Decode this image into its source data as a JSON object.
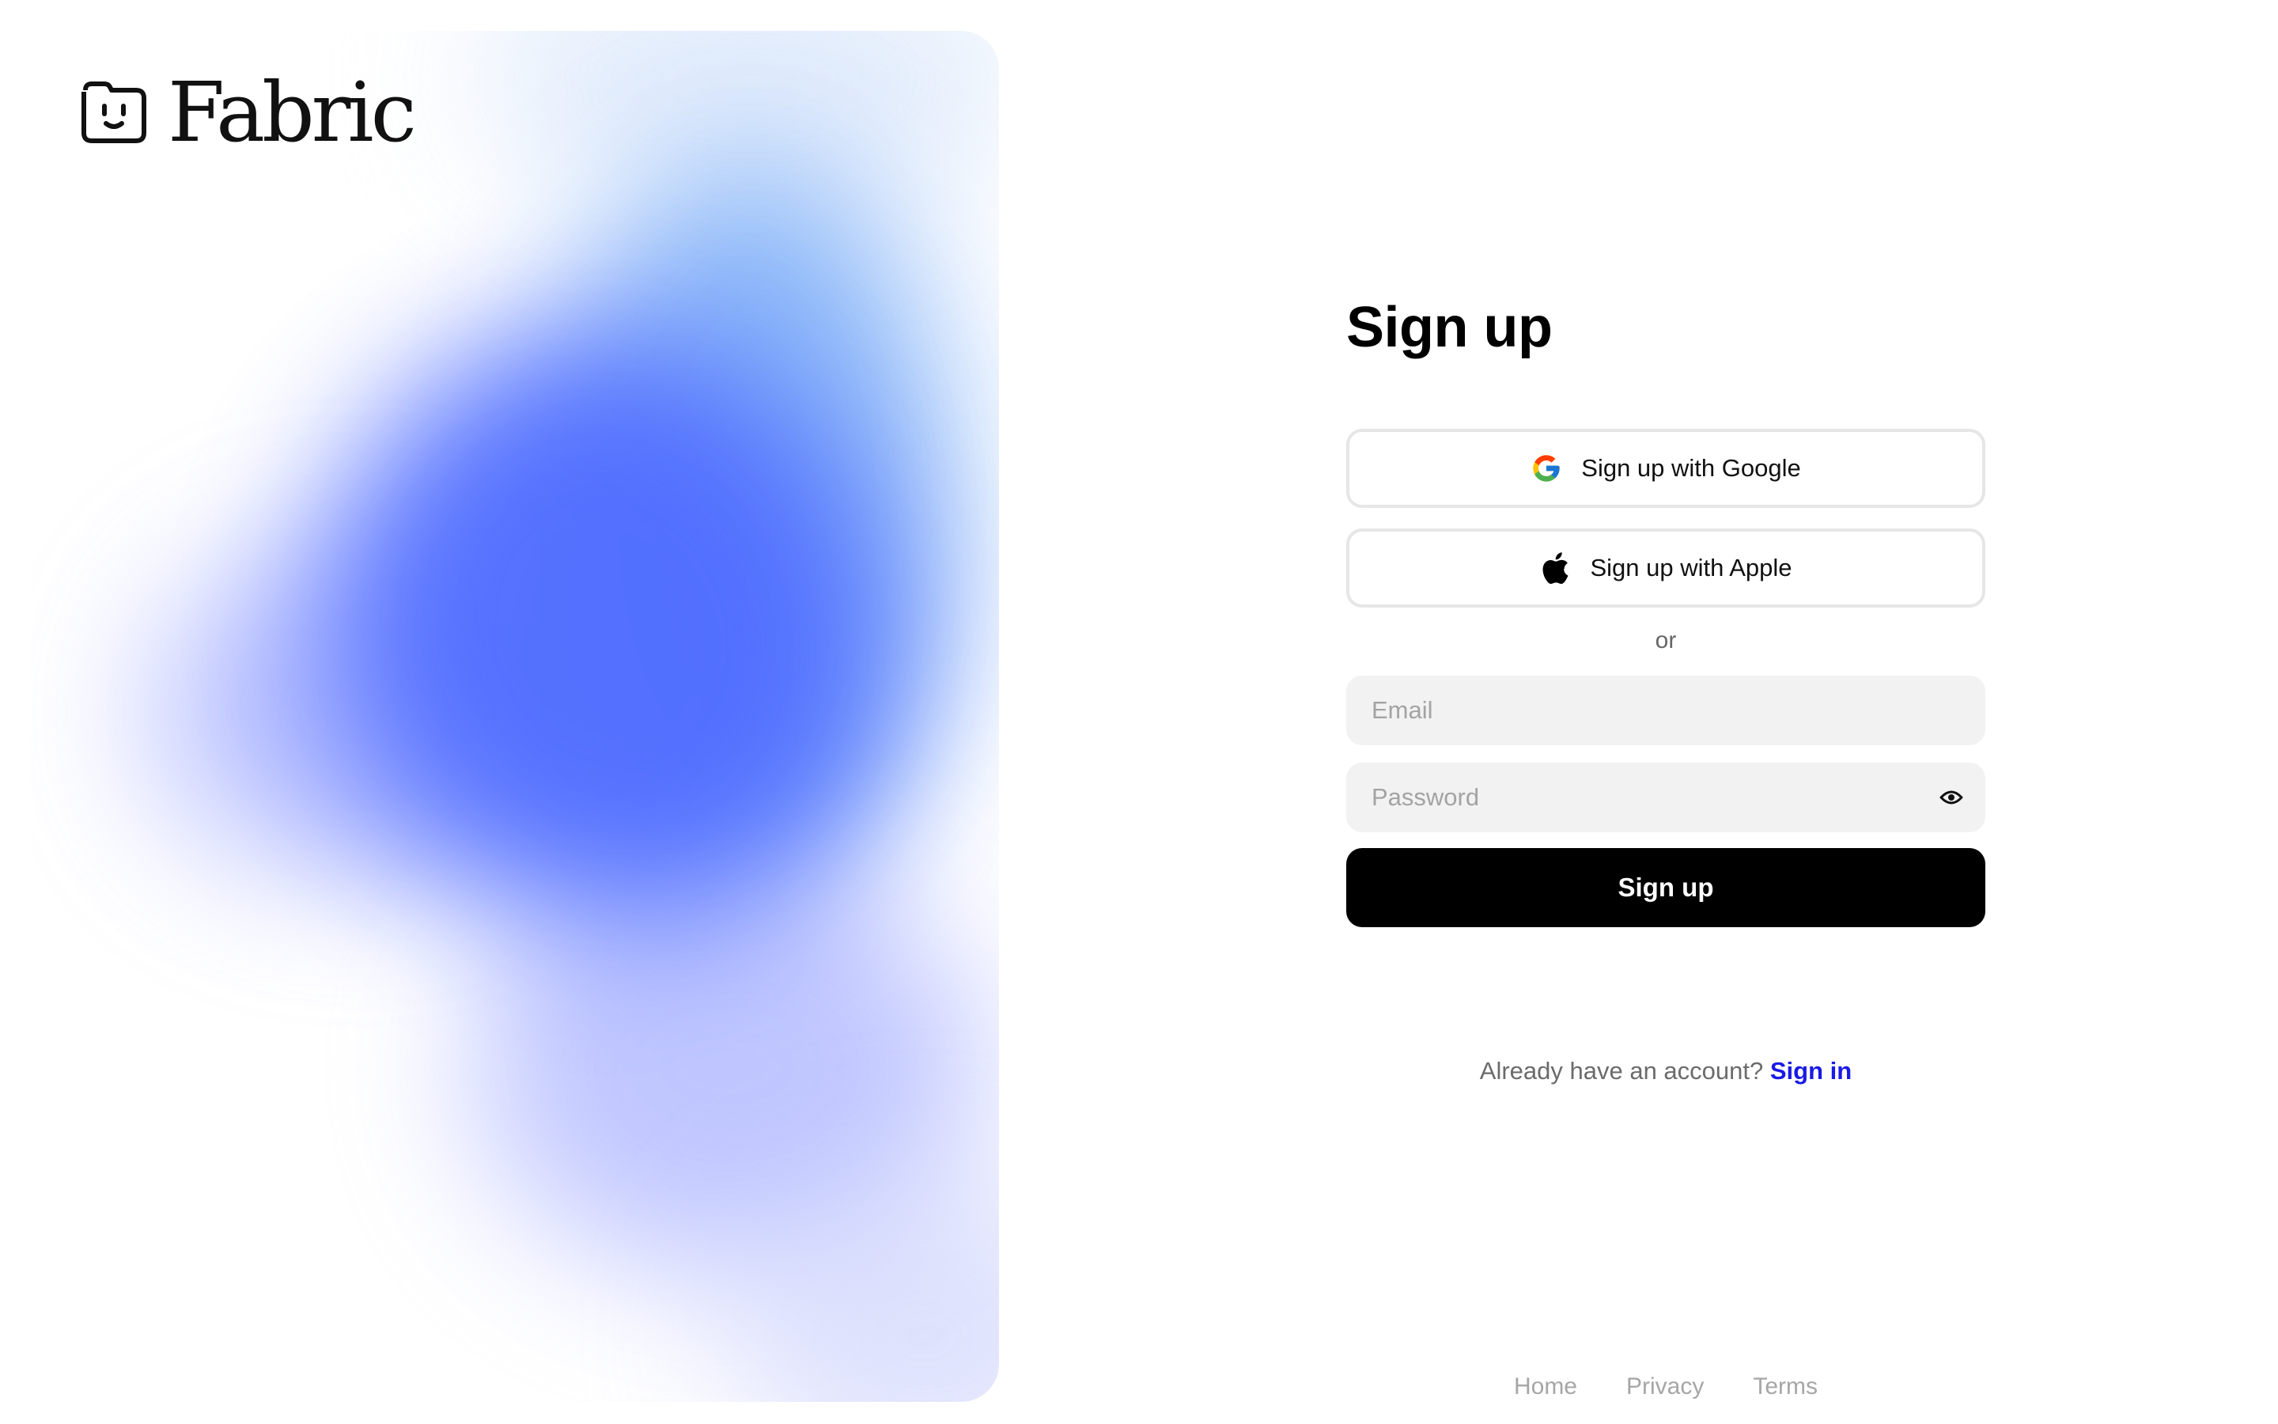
{
  "brand": {
    "name": "Fabric",
    "logo_icon": "smiling-folder-icon"
  },
  "form": {
    "title": "Sign up",
    "google_button": {
      "label": "Sign up with Google",
      "icon": "google-icon"
    },
    "apple_button": {
      "label": "Sign up with Apple",
      "icon": "apple-icon"
    },
    "divider": "or",
    "email": {
      "placeholder": "Email",
      "value": ""
    },
    "password": {
      "placeholder": "Password",
      "value": "",
      "toggle_icon": "eye-icon"
    },
    "submit_label": "Sign up"
  },
  "signin_prompt": {
    "text": "Already have an account?",
    "link": "Sign in",
    "link_color": "#1a1ae6"
  },
  "footer": {
    "links": [
      "Home",
      "Privacy",
      "Terms"
    ]
  },
  "colors": {
    "primary_button": "#000000",
    "field_background": "#f2f2f2",
    "gradient_core": "#4f6cff",
    "gradient_light": "#7fb0f8"
  }
}
